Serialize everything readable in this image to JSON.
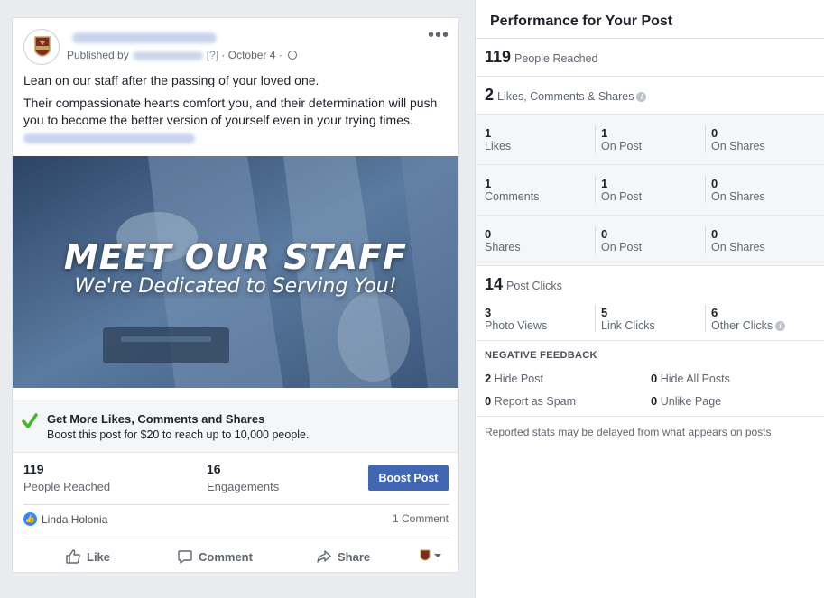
{
  "post": {
    "published_by": "Published by",
    "help_marker": "[?]",
    "date": "October 4",
    "menu_icon": "more-dots-icon",
    "text_line1": "Lean on our staff after the passing of your loved one.",
    "text_line2": "Their compassionate hearts comfort you, and their determination will push you to become the better version of yourself even in your trying times.",
    "image_title": "MEET OUR STAFF",
    "image_subtitle": "We're Dedicated to Serving You!",
    "promo_title": "Get More Likes, Comments and Shares",
    "promo_subtitle": "Boost this post for $20 to reach up to 10,000 people.",
    "reach_value": "119",
    "reach_label": "People Reached",
    "engagement_value": "16",
    "engagement_label": "Engagements",
    "boost_label": "Boost Post",
    "liker_name": "Linda Holonia",
    "comment_count": "1 Comment",
    "actions": {
      "like": "Like",
      "comment": "Comment",
      "share": "Share"
    }
  },
  "performance": {
    "title": "Performance for Your Post",
    "reached_value": "119",
    "reached_label": "People Reached",
    "lcs_value": "2",
    "lcs_label": "Likes, Comments & Shares",
    "grid": [
      {
        "a_val": "1",
        "a_lbl": "Likes",
        "b_val": "1",
        "b_lbl": "On Post",
        "c_val": "0",
        "c_lbl": "On Shares"
      },
      {
        "a_val": "1",
        "a_lbl": "Comments",
        "b_val": "1",
        "b_lbl": "On Post",
        "c_val": "0",
        "c_lbl": "On Shares"
      },
      {
        "a_val": "0",
        "a_lbl": "Shares",
        "b_val": "0",
        "b_lbl": "On Post",
        "c_val": "0",
        "c_lbl": "On Shares"
      }
    ],
    "clicks_value": "14",
    "clicks_label": "Post Clicks",
    "clicks": [
      {
        "val": "3",
        "lbl": "Photo Views"
      },
      {
        "val": "5",
        "lbl": "Link Clicks"
      },
      {
        "val": "6",
        "lbl": "Other Clicks"
      }
    ],
    "negative_title": "NEGATIVE FEEDBACK",
    "negative": {
      "hide_post_val": "2",
      "hide_post_lbl": "Hide Post",
      "hide_all_val": "0",
      "hide_all_lbl": "Hide All Posts",
      "spam_val": "0",
      "spam_lbl": "Report as Spam",
      "unlike_val": "0",
      "unlike_lbl": "Unlike Page"
    },
    "footnote": "Reported stats may be delayed from what appears on posts"
  },
  "colors": {
    "accent": "#4267b2",
    "background": "#e9ebee",
    "reaction": "#2d88ff",
    "promo_check": "#42b72a"
  }
}
